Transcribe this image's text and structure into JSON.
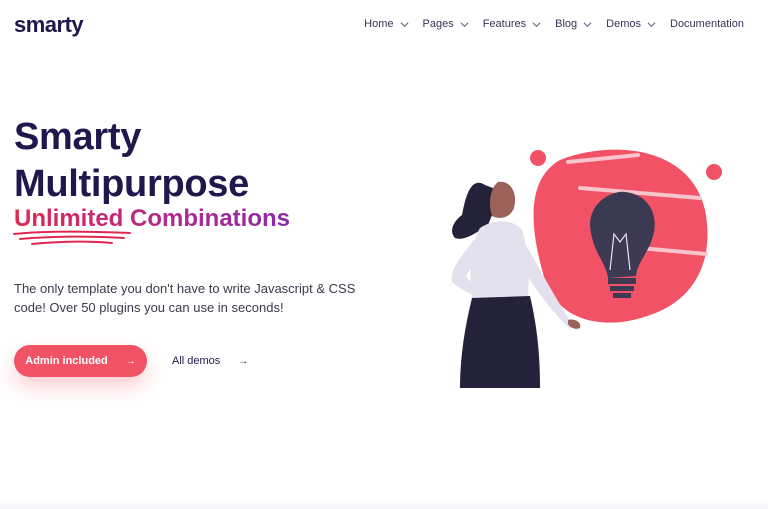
{
  "header": {
    "logo": "smarty",
    "nav": [
      {
        "label": "Home",
        "has_dropdown": true
      },
      {
        "label": "Pages",
        "has_dropdown": true
      },
      {
        "label": "Features",
        "has_dropdown": true
      },
      {
        "label": "Blog",
        "has_dropdown": true
      },
      {
        "label": "Demos",
        "has_dropdown": true
      },
      {
        "label": "Documentation",
        "has_dropdown": false
      }
    ]
  },
  "hero": {
    "title_line1": "Smarty",
    "title_line2": "Multipurpose",
    "subtitle": "Unlimited Combinations",
    "description": "The only template you don't have to write Javascript & CSS code! Over 50 plugins you can use in seconds!",
    "primary_button": "Admin included",
    "secondary_button": "All demos",
    "arrow_icon": "arrow-right-icon"
  },
  "colors": {
    "primary": "#f25266",
    "heading": "#22174d",
    "gradient_start": "#e0284f",
    "gradient_end": "#8a2aa8"
  }
}
